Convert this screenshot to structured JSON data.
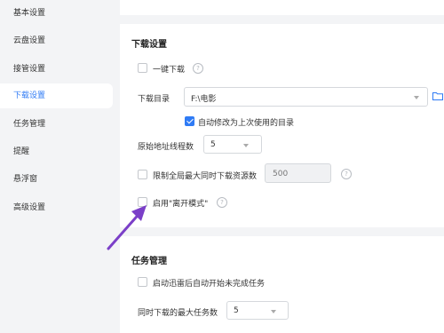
{
  "sidebar": {
    "items": [
      {
        "label": "基本设置"
      },
      {
        "label": "云盘设置"
      },
      {
        "label": "接管设置"
      },
      {
        "label": "下载设置"
      },
      {
        "label": "任务管理"
      },
      {
        "label": "提醒"
      },
      {
        "label": "悬浮窗"
      },
      {
        "label": "高级设置"
      }
    ],
    "active_index": 3
  },
  "download": {
    "title": "下载设置",
    "one_click": {
      "label": "一键下载",
      "checked": false
    },
    "dir_label": "下载目录",
    "dir_value": "F:\\电影",
    "auto_modify": {
      "label": "自动修改为上次使用的目录",
      "checked": true
    },
    "threads_label": "原始地址线程数",
    "threads_value": "5",
    "limit": {
      "label": "限制全局最大同时下载资源数",
      "checked": false
    },
    "limit_value": "500",
    "leave_mode": {
      "label": "启用\"离开模式\"",
      "checked": false
    }
  },
  "task": {
    "title": "任务管理",
    "auto_start": {
      "label": "启动迅雷后自动开始未完成任务",
      "checked": false
    },
    "max_label": "同时下载的最大任务数",
    "max_value": "5"
  },
  "icons": {
    "help": "?",
    "folder": "folder-icon",
    "arrow": "annotation-arrow"
  },
  "colors": {
    "accent": "#2f7bf5",
    "arrow": "#7b3fc8"
  }
}
